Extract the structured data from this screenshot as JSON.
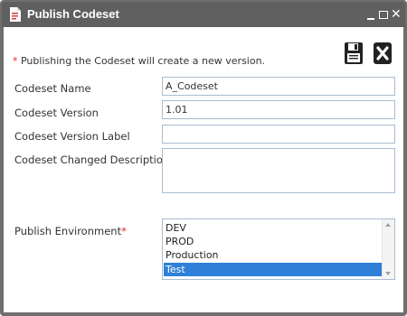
{
  "window": {
    "title": "Publish Codeset",
    "minimize_icon": "minimize-icon",
    "maximize_icon": "maximize-icon",
    "close_label": "✕"
  },
  "toolbar": {
    "save_icon": "floppy-disk-icon",
    "cancel_icon": "close-x-icon"
  },
  "note": {
    "asterisk": "*",
    "text": " Publishing the Codeset will create a new version."
  },
  "form": {
    "codeset_name": {
      "label": "Codeset Name",
      "value": "A_Codeset"
    },
    "codeset_version": {
      "label": "Codeset Version",
      "value": "1.01"
    },
    "version_label": {
      "label": "Codeset Version Label",
      "value": ""
    },
    "changed_description": {
      "label": "Codeset Changed Description",
      "required_mark": "*",
      "value": ""
    },
    "publish_environment": {
      "label": "Publish Environment",
      "required_mark": "*",
      "options": [
        "DEV",
        "PROD",
        "Production",
        "Test"
      ],
      "selected": "Test"
    }
  },
  "colors": {
    "titlebar": "#5f5f5f",
    "required": "#e02424",
    "field_border": "#a8bcd0",
    "selection": "#2f80d8"
  }
}
